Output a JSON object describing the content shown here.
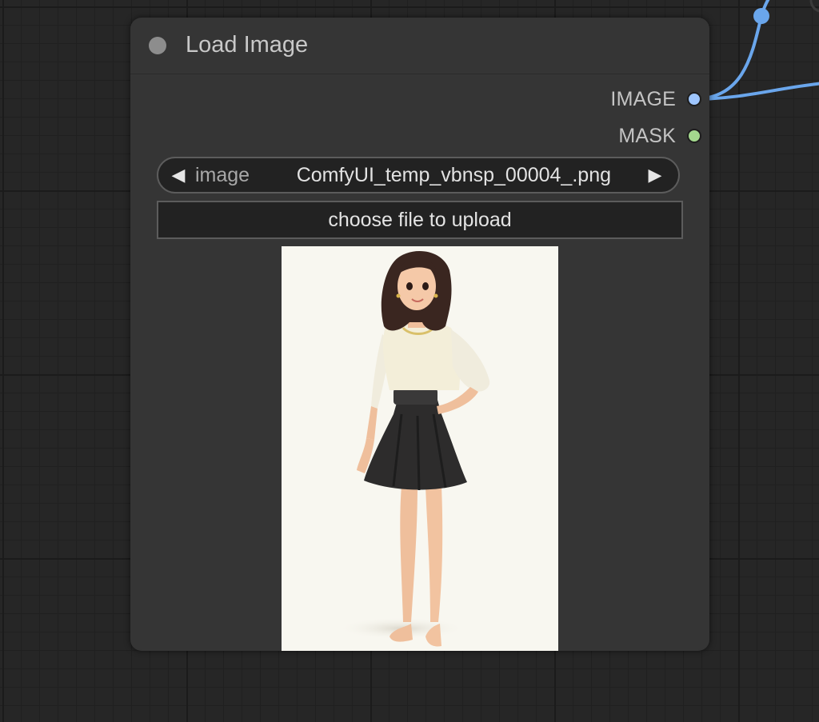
{
  "node": {
    "title": "Load Image",
    "outputs": [
      {
        "label": "IMAGE",
        "color": "#9ec6ff"
      },
      {
        "label": "MASK",
        "color": "#a4d98e"
      }
    ],
    "image_widget": {
      "label": "image",
      "value": "ComfyUI_temp_vbnsp_00004_.png",
      "prev_glyph": "◀",
      "next_glyph": "▶"
    },
    "upload_button_label": "choose file to upload"
  },
  "colors": {
    "link": "#6aa6ec",
    "node_bg": "#353535",
    "canvas_bg": "#262626"
  }
}
